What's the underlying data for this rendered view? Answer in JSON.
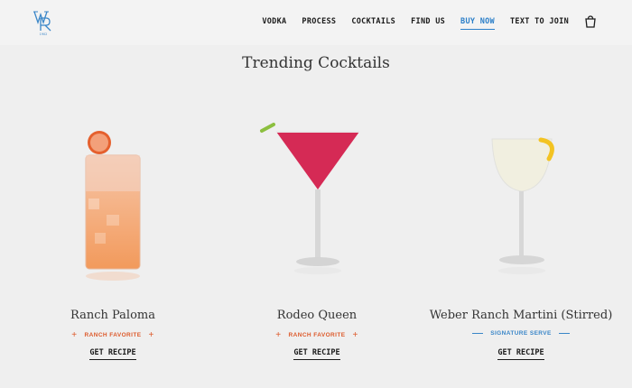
{
  "brand": {
    "logo_subtext": "1902"
  },
  "nav": {
    "items": [
      "VODKA",
      "PROCESS",
      "COCKTAILS",
      "FIND US",
      "BUY NOW",
      "TEXT TO JOIN"
    ],
    "active_index": 4
  },
  "section": {
    "title": "Trending Cocktails"
  },
  "cocktails": [
    {
      "name": "Ranch Paloma",
      "tag": "RANCH FAVORITE",
      "tag_color": "#dd5a2b",
      "cta": "GET RECIPE"
    },
    {
      "name": "Rodeo Queen",
      "tag": "RANCH FAVORITE",
      "tag_color": "#dd5a2b",
      "cta": "GET RECIPE"
    },
    {
      "name": "Weber Ranch Martini (Stirred)",
      "tag": "SIGNATURE SERVE",
      "tag_color": "#3a86c8",
      "cta": "GET RECIPE"
    }
  ],
  "colors": {
    "accent": "#2b7fc9",
    "orange": "#dd5a2b",
    "background": "#efefef"
  }
}
